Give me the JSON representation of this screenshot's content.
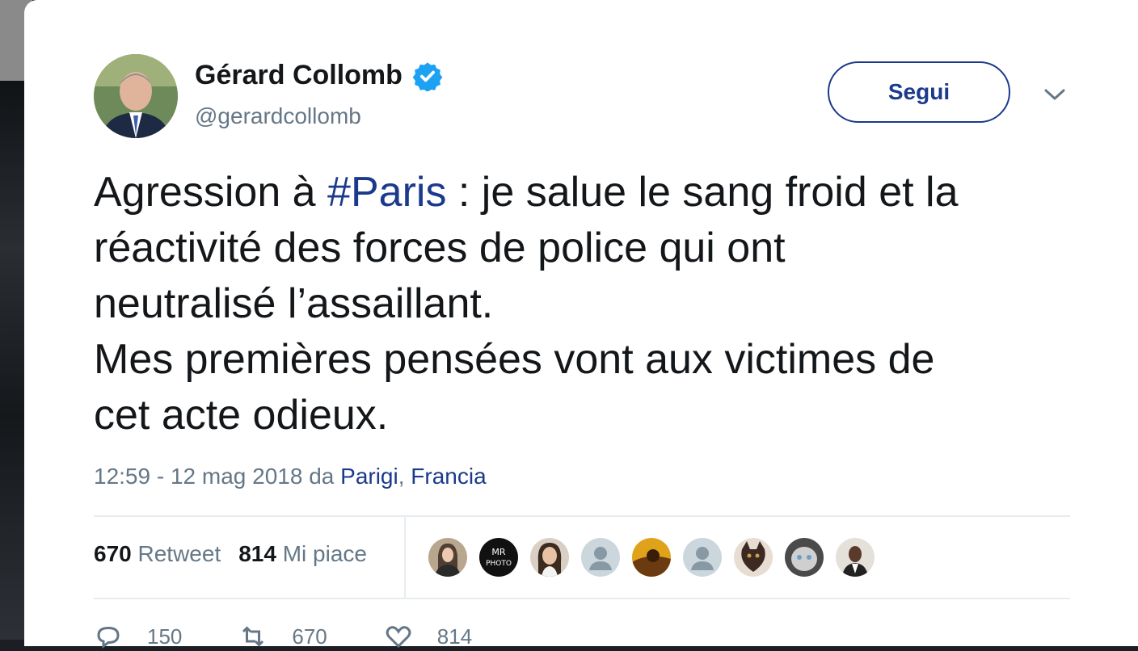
{
  "author": {
    "name": "Gérard Collomb",
    "handle": "@gerardcollomb"
  },
  "follow_button": {
    "label": "Segui"
  },
  "tweet": {
    "lines": [
      "réactivité des forces de police qui ont",
      "neutralisé l’assaillant.",
      "Mes premières pensées vont aux victimes de",
      "cet acte odieux."
    ],
    "first_line_prefix": "Agression à ",
    "hashtag": "#Paris",
    "first_line_suffix": " : je salue le sang froid et la"
  },
  "meta": {
    "time": "12:59 - 12 mag 2018",
    "from_word": "da",
    "place_city": "Parigi",
    "place_country": "Francia"
  },
  "stats": {
    "retweets_count": "670",
    "retweets_label": "Retweet",
    "likes_count": "814",
    "likes_label": "Mi piace"
  },
  "facepile": [
    {
      "icon": "avatar-photo"
    },
    {
      "icon": "avatar-text",
      "text": "MR PHOTO"
    },
    {
      "icon": "avatar-photo"
    },
    {
      "icon": "default-avatar-icon"
    },
    {
      "icon": "avatar-photo"
    },
    {
      "icon": "default-avatar-icon"
    },
    {
      "icon": "avatar-photo"
    },
    {
      "icon": "avatar-photo"
    },
    {
      "icon": "avatar-photo"
    }
  ],
  "actions": {
    "replies": "150",
    "retweets": "670",
    "likes": "814"
  },
  "colors": {
    "accent": "#1b3a8c",
    "verified": "#1da1f2",
    "text": "#14171a",
    "muted": "#657786"
  }
}
